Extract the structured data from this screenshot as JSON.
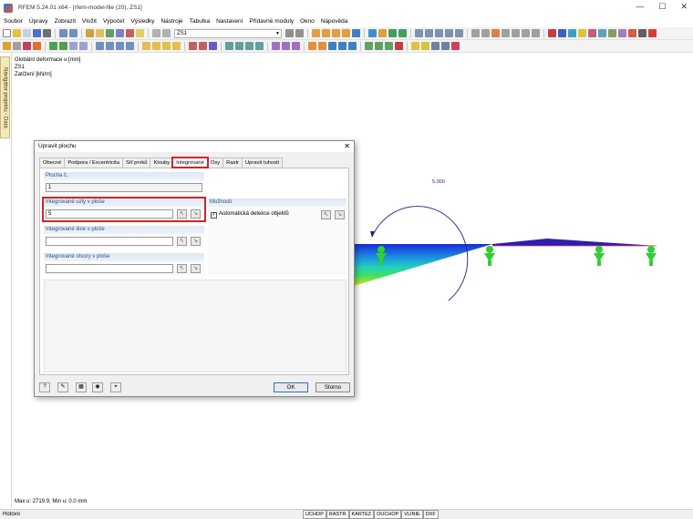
{
  "window": {
    "title": "RFEM 5.24.01 x64 - [rfem-model-file (20), ZS1]",
    "minimize": "—",
    "maximize": "☐",
    "close": "✕"
  },
  "menu": [
    "Soubor",
    "Úpravy",
    "Zobrazit",
    "Vložit",
    "Výpočet",
    "Výsledky",
    "Nástroje",
    "Tabulka",
    "Nastavení",
    "Přídavné moduly",
    "Okno",
    "Nápověda"
  ],
  "toolbar": {
    "load_case": "ZS1"
  },
  "navigator_tab": "Navigátor projektu - Data",
  "info_lines": [
    "Globální deformace u [mm]",
    "ZS1",
    "Zatížení [kN/m]"
  ],
  "moment_label": "5.000",
  "bottom_info": "Max u: 2719.9, Min u: 0.0 mm",
  "status": {
    "left": "Hotovo",
    "toggles": [
      "UCHOP",
      "RASTR",
      "KARTEZ",
      "OUCHOP",
      "VLINIE",
      "DXF"
    ]
  },
  "dialog": {
    "title": "Upravit plochu",
    "tabs": [
      "Obecné",
      "Podpora / Excentricita",
      "Síť prvků",
      "Klouby",
      "Integrované",
      "Osy",
      "Rastr",
      "Upravit tuhosti"
    ],
    "active_tab": "Integrované",
    "surface_no_label": "Plocha č.",
    "surface_no_value": "1",
    "nodes_label": "Integrované uzly v ploše",
    "nodes_value": "5",
    "lines_label": "Integrované linie v ploše",
    "lines_value": "",
    "openings_label": "Integrované otvory v ploše",
    "openings_value": "",
    "options_label": "Možnosti",
    "auto_detect_label": "Automatická detekce objektů",
    "auto_detect_checked": true,
    "ok_label": "OK",
    "cancel_label": "Storno"
  }
}
